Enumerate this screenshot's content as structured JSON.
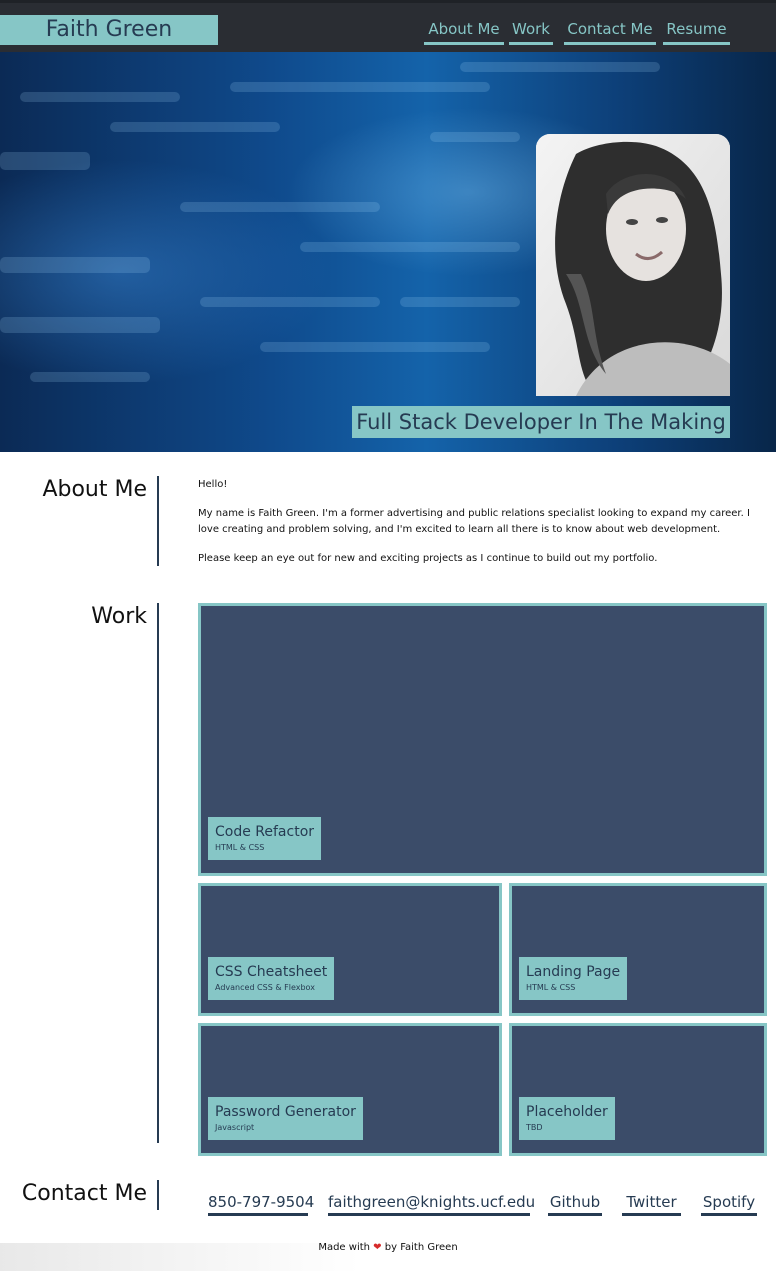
{
  "header": {
    "brand": "Faith Green",
    "nav": [
      "About Me",
      "Work",
      "Contact Me",
      "Resume"
    ]
  },
  "hero": {
    "tagline": "Full Stack Developer In The Making"
  },
  "about": {
    "title": "About Me",
    "paragraphs": [
      "Hello!",
      "My name is Faith Green. I'm a former advertising and public relations specialist looking to expand my career. I love creating and problem solving, and I'm excited to learn all there is to know about web development.",
      "Please keep an eye out for new and exciting projects as I continue to build out my portfolio."
    ]
  },
  "work": {
    "title": "Work",
    "projects": [
      {
        "title": "Code Refactor",
        "tech": "HTML & CSS"
      },
      {
        "title": "CSS Cheatsheet",
        "tech": "Advanced CSS & Flexbox"
      },
      {
        "title": "Landing Page",
        "tech": "HTML & CSS"
      },
      {
        "title": "Password Generator",
        "tech": "Javascript"
      },
      {
        "title": "Placeholder",
        "tech": "TBD"
      }
    ]
  },
  "contact": {
    "title": "Contact Me",
    "links": [
      "850-797-9504",
      "faithgreen@knights.ucf.edu",
      "Github",
      "Twitter",
      "Spotify"
    ]
  },
  "footer": {
    "prefix": "Made with",
    "heart": "❤",
    "suffix": "by Faith Green"
  },
  "colors": {
    "accent": "#86c6c6",
    "navy": "#263b52",
    "card": "#3b4c69",
    "header": "#2a2d33"
  }
}
